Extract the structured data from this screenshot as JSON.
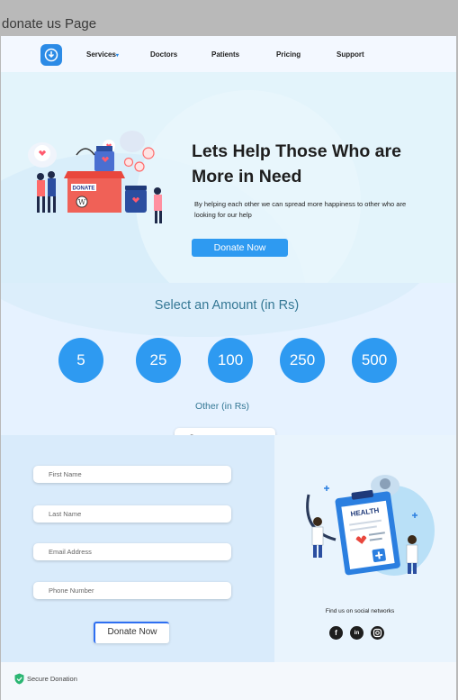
{
  "window": {
    "title": "donate us Page"
  },
  "nav": {
    "items": [
      {
        "label": "Services"
      },
      {
        "label": "Doctors"
      },
      {
        "label": "Patients"
      },
      {
        "label": "Pricing"
      },
      {
        "label": "Support"
      }
    ],
    "logo_icon": "download-icon",
    "services_caret": "▾"
  },
  "hero": {
    "title": "Lets Help Those Who are More in Need",
    "text": "By helping each other we can spread more happiness to other who are looking for our help",
    "button": "Donate Now",
    "illustration": {
      "box_label": "DONATE"
    }
  },
  "amount": {
    "title": "Select an Amount (in Rs)",
    "options": [
      "5",
      "25",
      "100",
      "250",
      "500"
    ],
    "other_label": "Other (in Rs)",
    "other_placeholder": "0"
  },
  "form": {
    "first_name_placeholder": "First Name",
    "last_name_placeholder": "Last Name",
    "email_placeholder": "Email Address",
    "phone_placeholder": "Phone Number",
    "button": "Donate Now"
  },
  "illustration": {
    "clipboard_label": "HEALTH",
    "find_us": "Find us on social networks",
    "social": [
      "facebook-icon",
      "linkedin-icon",
      "instagram-icon"
    ]
  },
  "footer": {
    "secure": "Secure Donation"
  },
  "colors": {
    "accent": "#2e9af1",
    "heading": "#357895",
    "text": "#1e1e1e"
  }
}
